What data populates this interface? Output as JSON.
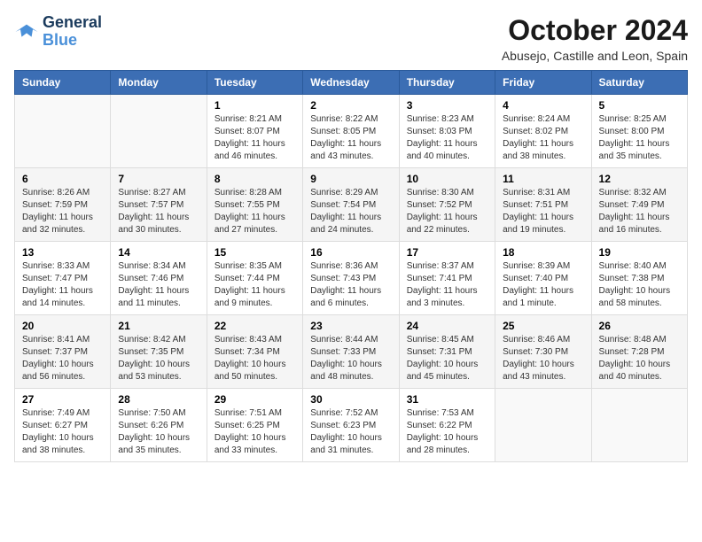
{
  "logo": {
    "line1": "General",
    "line2": "Blue"
  },
  "title": "October 2024",
  "subtitle": "Abusejo, Castille and Leon, Spain",
  "headers": [
    "Sunday",
    "Monday",
    "Tuesday",
    "Wednesday",
    "Thursday",
    "Friday",
    "Saturday"
  ],
  "weeks": [
    [
      {
        "day": "",
        "sunrise": "",
        "sunset": "",
        "daylight": ""
      },
      {
        "day": "",
        "sunrise": "",
        "sunset": "",
        "daylight": ""
      },
      {
        "day": "1",
        "sunrise": "Sunrise: 8:21 AM",
        "sunset": "Sunset: 8:07 PM",
        "daylight": "Daylight: 11 hours and 46 minutes."
      },
      {
        "day": "2",
        "sunrise": "Sunrise: 8:22 AM",
        "sunset": "Sunset: 8:05 PM",
        "daylight": "Daylight: 11 hours and 43 minutes."
      },
      {
        "day": "3",
        "sunrise": "Sunrise: 8:23 AM",
        "sunset": "Sunset: 8:03 PM",
        "daylight": "Daylight: 11 hours and 40 minutes."
      },
      {
        "day": "4",
        "sunrise": "Sunrise: 8:24 AM",
        "sunset": "Sunset: 8:02 PM",
        "daylight": "Daylight: 11 hours and 38 minutes."
      },
      {
        "day": "5",
        "sunrise": "Sunrise: 8:25 AM",
        "sunset": "Sunset: 8:00 PM",
        "daylight": "Daylight: 11 hours and 35 minutes."
      }
    ],
    [
      {
        "day": "6",
        "sunrise": "Sunrise: 8:26 AM",
        "sunset": "Sunset: 7:59 PM",
        "daylight": "Daylight: 11 hours and 32 minutes."
      },
      {
        "day": "7",
        "sunrise": "Sunrise: 8:27 AM",
        "sunset": "Sunset: 7:57 PM",
        "daylight": "Daylight: 11 hours and 30 minutes."
      },
      {
        "day": "8",
        "sunrise": "Sunrise: 8:28 AM",
        "sunset": "Sunset: 7:55 PM",
        "daylight": "Daylight: 11 hours and 27 minutes."
      },
      {
        "day": "9",
        "sunrise": "Sunrise: 8:29 AM",
        "sunset": "Sunset: 7:54 PM",
        "daylight": "Daylight: 11 hours and 24 minutes."
      },
      {
        "day": "10",
        "sunrise": "Sunrise: 8:30 AM",
        "sunset": "Sunset: 7:52 PM",
        "daylight": "Daylight: 11 hours and 22 minutes."
      },
      {
        "day": "11",
        "sunrise": "Sunrise: 8:31 AM",
        "sunset": "Sunset: 7:51 PM",
        "daylight": "Daylight: 11 hours and 19 minutes."
      },
      {
        "day": "12",
        "sunrise": "Sunrise: 8:32 AM",
        "sunset": "Sunset: 7:49 PM",
        "daylight": "Daylight: 11 hours and 16 minutes."
      }
    ],
    [
      {
        "day": "13",
        "sunrise": "Sunrise: 8:33 AM",
        "sunset": "Sunset: 7:47 PM",
        "daylight": "Daylight: 11 hours and 14 minutes."
      },
      {
        "day": "14",
        "sunrise": "Sunrise: 8:34 AM",
        "sunset": "Sunset: 7:46 PM",
        "daylight": "Daylight: 11 hours and 11 minutes."
      },
      {
        "day": "15",
        "sunrise": "Sunrise: 8:35 AM",
        "sunset": "Sunset: 7:44 PM",
        "daylight": "Daylight: 11 hours and 9 minutes."
      },
      {
        "day": "16",
        "sunrise": "Sunrise: 8:36 AM",
        "sunset": "Sunset: 7:43 PM",
        "daylight": "Daylight: 11 hours and 6 minutes."
      },
      {
        "day": "17",
        "sunrise": "Sunrise: 8:37 AM",
        "sunset": "Sunset: 7:41 PM",
        "daylight": "Daylight: 11 hours and 3 minutes."
      },
      {
        "day": "18",
        "sunrise": "Sunrise: 8:39 AM",
        "sunset": "Sunset: 7:40 PM",
        "daylight": "Daylight: 11 hours and 1 minute."
      },
      {
        "day": "19",
        "sunrise": "Sunrise: 8:40 AM",
        "sunset": "Sunset: 7:38 PM",
        "daylight": "Daylight: 10 hours and 58 minutes."
      }
    ],
    [
      {
        "day": "20",
        "sunrise": "Sunrise: 8:41 AM",
        "sunset": "Sunset: 7:37 PM",
        "daylight": "Daylight: 10 hours and 56 minutes."
      },
      {
        "day": "21",
        "sunrise": "Sunrise: 8:42 AM",
        "sunset": "Sunset: 7:35 PM",
        "daylight": "Daylight: 10 hours and 53 minutes."
      },
      {
        "day": "22",
        "sunrise": "Sunrise: 8:43 AM",
        "sunset": "Sunset: 7:34 PM",
        "daylight": "Daylight: 10 hours and 50 minutes."
      },
      {
        "day": "23",
        "sunrise": "Sunrise: 8:44 AM",
        "sunset": "Sunset: 7:33 PM",
        "daylight": "Daylight: 10 hours and 48 minutes."
      },
      {
        "day": "24",
        "sunrise": "Sunrise: 8:45 AM",
        "sunset": "Sunset: 7:31 PM",
        "daylight": "Daylight: 10 hours and 45 minutes."
      },
      {
        "day": "25",
        "sunrise": "Sunrise: 8:46 AM",
        "sunset": "Sunset: 7:30 PM",
        "daylight": "Daylight: 10 hours and 43 minutes."
      },
      {
        "day": "26",
        "sunrise": "Sunrise: 8:48 AM",
        "sunset": "Sunset: 7:28 PM",
        "daylight": "Daylight: 10 hours and 40 minutes."
      }
    ],
    [
      {
        "day": "27",
        "sunrise": "Sunrise: 7:49 AM",
        "sunset": "Sunset: 6:27 PM",
        "daylight": "Daylight: 10 hours and 38 minutes."
      },
      {
        "day": "28",
        "sunrise": "Sunrise: 7:50 AM",
        "sunset": "Sunset: 6:26 PM",
        "daylight": "Daylight: 10 hours and 35 minutes."
      },
      {
        "day": "29",
        "sunrise": "Sunrise: 7:51 AM",
        "sunset": "Sunset: 6:25 PM",
        "daylight": "Daylight: 10 hours and 33 minutes."
      },
      {
        "day": "30",
        "sunrise": "Sunrise: 7:52 AM",
        "sunset": "Sunset: 6:23 PM",
        "daylight": "Daylight: 10 hours and 31 minutes."
      },
      {
        "day": "31",
        "sunrise": "Sunrise: 7:53 AM",
        "sunset": "Sunset: 6:22 PM",
        "daylight": "Daylight: 10 hours and 28 minutes."
      },
      {
        "day": "",
        "sunrise": "",
        "sunset": "",
        "daylight": ""
      },
      {
        "day": "",
        "sunrise": "",
        "sunset": "",
        "daylight": ""
      }
    ]
  ]
}
